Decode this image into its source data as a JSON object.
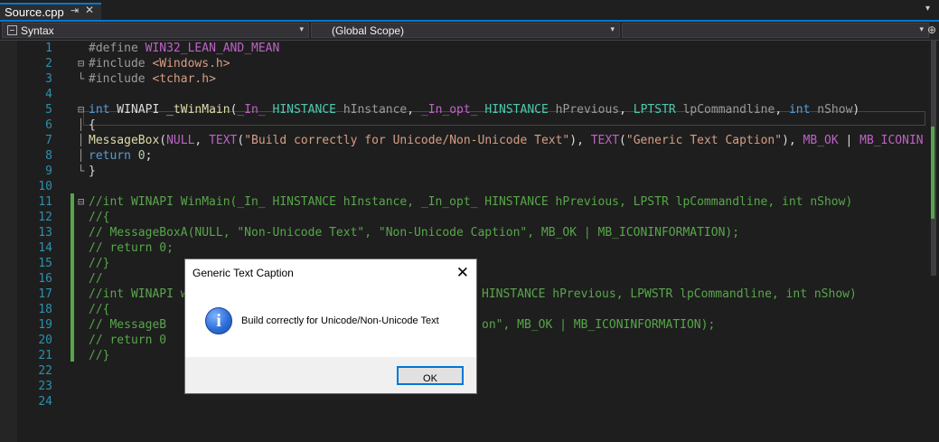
{
  "tab": {
    "title": "Source.cpp",
    "pin_icon": "pin-icon",
    "close_glyph": "✕",
    "dropdown_glyph": "▾"
  },
  "navbar": {
    "project_combo": "Syntax",
    "scope_combo": "(Global Scope)",
    "member_combo": "",
    "arrow": "▾",
    "split_glyph": "⊕"
  },
  "editor": {
    "line_numbers": [
      "1",
      "2",
      "3",
      "4",
      "5",
      "6",
      "7",
      "8",
      "9",
      "10",
      "11",
      "12",
      "13",
      "14",
      "15",
      "16",
      "17",
      "18",
      "19",
      "20",
      "21",
      "22",
      "23",
      "24"
    ],
    "outline_glyphs": {
      "collapse": "⊟",
      "vbar": "│",
      "end": "└"
    },
    "lines": {
      "l1": [
        "#define ",
        "WIN32_LEAN_AND_MEAN"
      ],
      "l2": [
        "#include ",
        "<Windows.h>"
      ],
      "l3": [
        "#include ",
        "<tchar.h>"
      ],
      "l5": [
        "int",
        " WINAPI ",
        "_tWinMain",
        "(",
        "_In_",
        " ",
        "HINSTANCE",
        " ",
        "hInstance",
        ", ",
        "_In_opt_",
        " ",
        "HINSTANCE",
        " ",
        "hPrevious",
        ", ",
        "LPTSTR",
        " ",
        "lpCommandline",
        ", ",
        "int",
        " ",
        "nShow",
        ")"
      ],
      "l6": [
        "{"
      ],
      "l7": [
        "    ",
        "MessageBox",
        "(",
        "NULL",
        ", ",
        "TEXT",
        "(",
        "\"Build correctly for Unicode/Non-Unicode Text\"",
        "), ",
        "TEXT",
        "(",
        "\"Generic Text Caption\"",
        "), ",
        "MB_OK",
        " | ",
        "MB_ICONIN"
      ],
      "l8": [
        "    ",
        "return",
        " ",
        "0",
        ";"
      ],
      "l9": [
        "}"
      ],
      "l11": "//int WINAPI WinMain(_In_ HINSTANCE hInstance, _In_opt_ HINSTANCE hPrevious, LPSTR lpCommandline, int nShow)",
      "l12": "//{",
      "l13": "//    MessageBoxA(NULL, \"Non-Unicode Text\", \"Non-Unicode Caption\", MB_OK | MB_ICONINFORMATION);",
      "l14": "//    return 0;",
      "l15": "//}",
      "l16": "//",
      "l17": "//int WINAPI w",
      "l17b": "HINSTANCE hPrevious, LPWSTR lpCommandline, int nShow)",
      "l18": "//{",
      "l19": "//    MessageB",
      "l19b": "on\", MB_OK | MB_ICONINFORMATION);",
      "l20": "//    return 0",
      "l21": "//}"
    }
  },
  "dialog": {
    "title": "Generic Text Caption",
    "close_glyph": "✕",
    "icon": "info-icon",
    "icon_glyph": "i",
    "message": "Build correctly for Unicode/Non-Unicode Text",
    "ok_label": "OK"
  }
}
